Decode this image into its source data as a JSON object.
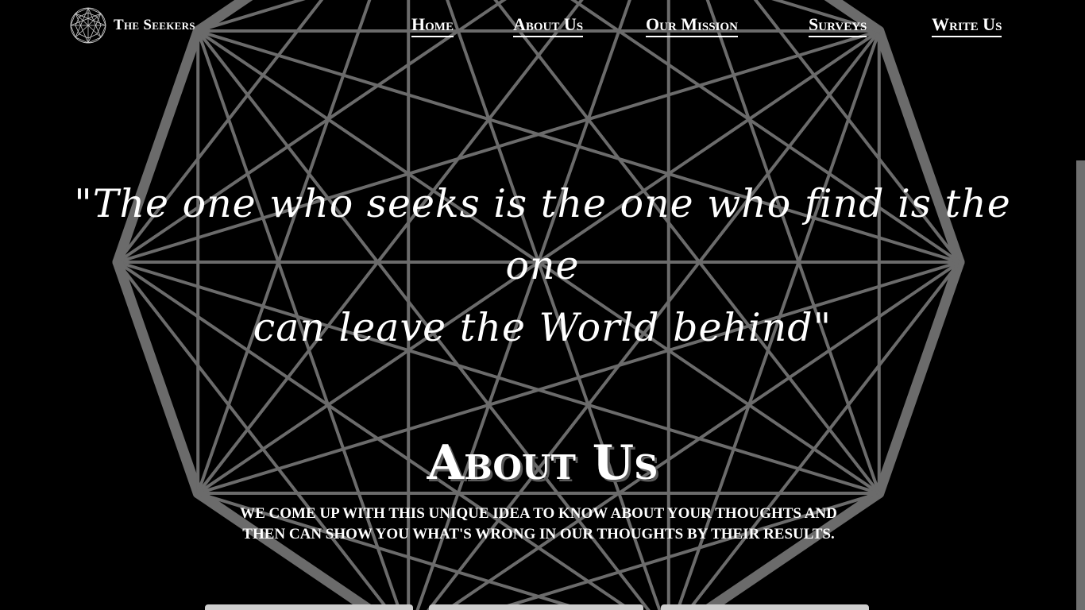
{
  "brand": {
    "name": "The Seekers",
    "logo_icon": "geodesic-sphere-icon"
  },
  "nav": {
    "items": [
      {
        "label": "Home"
      },
      {
        "label": "About Us"
      },
      {
        "label": "Our Mission"
      },
      {
        "label": "Surveys"
      },
      {
        "label": "Write Us"
      }
    ]
  },
  "hero": {
    "quote_line1": "\"The one who seeks is the one who find is the one",
    "quote_line2": "can leave the World behind\""
  },
  "about": {
    "title": "About Us",
    "text_line1": "We come up with this unique idea to know about your thoughts and",
    "text_line2": "then can show you what's wrong in our thoughts by their results."
  },
  "colors": {
    "background": "#000000",
    "figure_lines": "#6b6b6b",
    "text": "#ffffff"
  }
}
